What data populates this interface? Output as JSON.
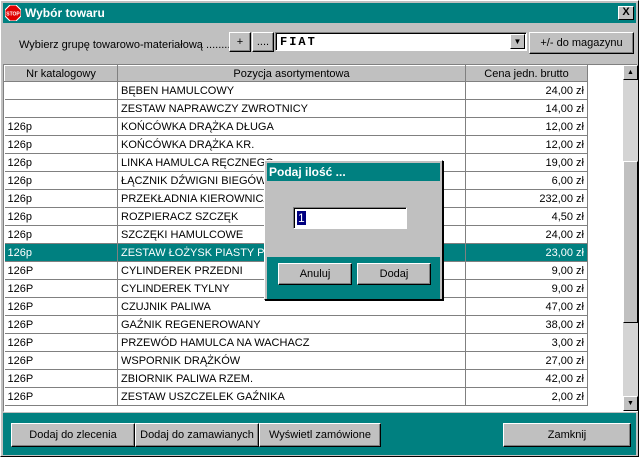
{
  "window": {
    "title": "Wybór towaru",
    "close_label": "X"
  },
  "toolbar": {
    "group_label": "Wybierz grupę towarowo-materiałową ........",
    "plus_label": "+",
    "dots_label": "....",
    "group_value": "FIAT",
    "stock_button": "+/- do magazynu"
  },
  "table": {
    "headers": [
      "Nr katalogowy",
      "Pozycja asortymentowa",
      "Cena jedn. brutto"
    ],
    "rows": [
      {
        "nr": "",
        "name": "BĘBEN HAMULCOWY",
        "price": "24,00 zł"
      },
      {
        "nr": "",
        "name": "ZESTAW NAPRAWCZY ZWROTNICY",
        "price": "14,00 zł"
      },
      {
        "nr": "126p",
        "name": "KOŃCÓWKA DRĄŻKA DŁUGA",
        "price": "12,00 zł"
      },
      {
        "nr": "126p",
        "name": "KOŃCÓWKA DRĄŻKA KR.",
        "price": "12,00 zł"
      },
      {
        "nr": "126p",
        "name": "LINKA HAMULCA RĘCZNEGO",
        "price": "19,00 zł"
      },
      {
        "nr": "126p",
        "name": "ŁĄCZNIK DŹWIGNI BIEGÓW",
        "price": "6,00 zł"
      },
      {
        "nr": "126p",
        "name": "PRZEKŁADNIA KIEROWNICZA",
        "price": "232,00 zł"
      },
      {
        "nr": "126p",
        "name": "ROZPIERACZ SZCZĘK",
        "price": "4,50 zł"
      },
      {
        "nr": "126p",
        "name": "SZCZĘKI HAMULCOWE",
        "price": "24,00 zł"
      },
      {
        "nr": "126p",
        "name": "ZESTAW ŁOŻYSK PIASTY PRZEDNIEJ",
        "price": "23,00 zł",
        "selected": true
      },
      {
        "nr": "126P",
        "name": "CYLINDEREK PRZEDNI",
        "price": "9,00 zł"
      },
      {
        "nr": "126P",
        "name": "CYLINDEREK TYLNY",
        "price": "9,00 zł"
      },
      {
        "nr": "126P",
        "name": "CZUJNIK PALIWA",
        "price": "47,00 zł"
      },
      {
        "nr": "126P",
        "name": "GAŹNIK REGENEROWANY",
        "price": "38,00 zł"
      },
      {
        "nr": "126P",
        "name": "PRZEWÓD HAMULCA NA WACHACZ",
        "price": "3,00 zł"
      },
      {
        "nr": "126P",
        "name": "WSPORNIK DRĄŻKÓW",
        "price": "27,00 zł"
      },
      {
        "nr": "126P",
        "name": "ZBIORNIK PALIWA RZEM.",
        "price": "42,00 zł"
      },
      {
        "nr": "126P",
        "name": "ZESTAW USZCZELEK GAŹNIKA",
        "price": "2,00 zł"
      }
    ]
  },
  "bottom": {
    "add_order": "Dodaj do zlecenia",
    "add_ordered": "Dodaj do zamawianych",
    "show_order": "Wyświetl zamówione",
    "close": "Zamknij"
  },
  "dialog": {
    "title": "Podaj ilość ...",
    "value": "1",
    "cancel": "Anuluj",
    "add": "Dodaj"
  },
  "icons": {
    "stop": "stop-icon",
    "accent": "#008080"
  }
}
